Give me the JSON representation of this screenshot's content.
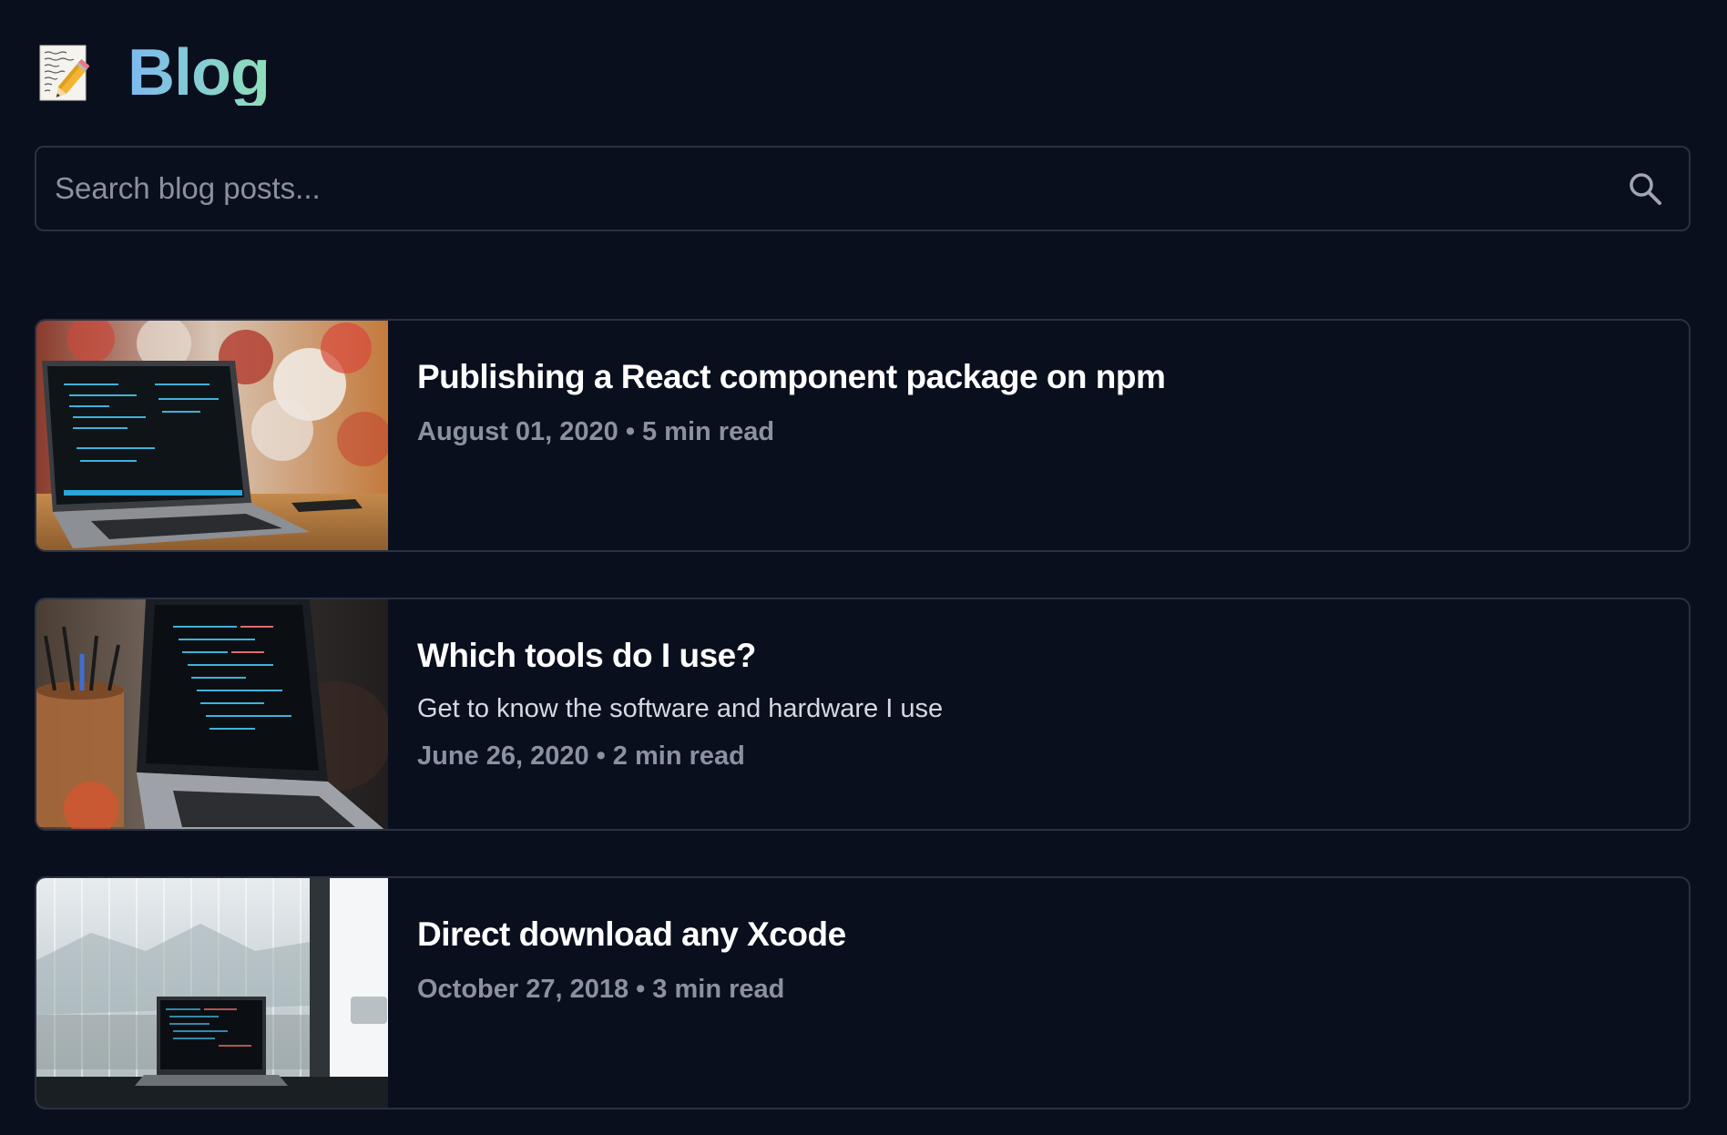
{
  "header": {
    "title": "Blog",
    "icon": "memo-icon"
  },
  "search": {
    "placeholder": "Search blog posts...",
    "value": "",
    "icon": "search-icon"
  },
  "posts": [
    {
      "title": "Publishing a React component package on npm",
      "description": "",
      "date": "August 01, 2020",
      "read_time": "5 min read",
      "thumbnail": "laptop-with-code-on-wooden-table"
    },
    {
      "title": "Which tools do I use?",
      "description": "Get to know the software and hardware I use",
      "date": "June 26, 2020",
      "read_time": "2 min read",
      "thumbnail": "laptop-with-code-and-pen-holder"
    },
    {
      "title": "Direct download any Xcode",
      "description": "",
      "date": "October 27, 2018",
      "read_time": "3 min read",
      "thumbnail": "laptop-by-window"
    }
  ],
  "colors": {
    "background": "#0a0f1e",
    "border": "#2a3142",
    "title_gradient_start": "#7cb9f0",
    "title_gradient_end": "#8fe0b8",
    "meta_text": "#8a91a0"
  }
}
